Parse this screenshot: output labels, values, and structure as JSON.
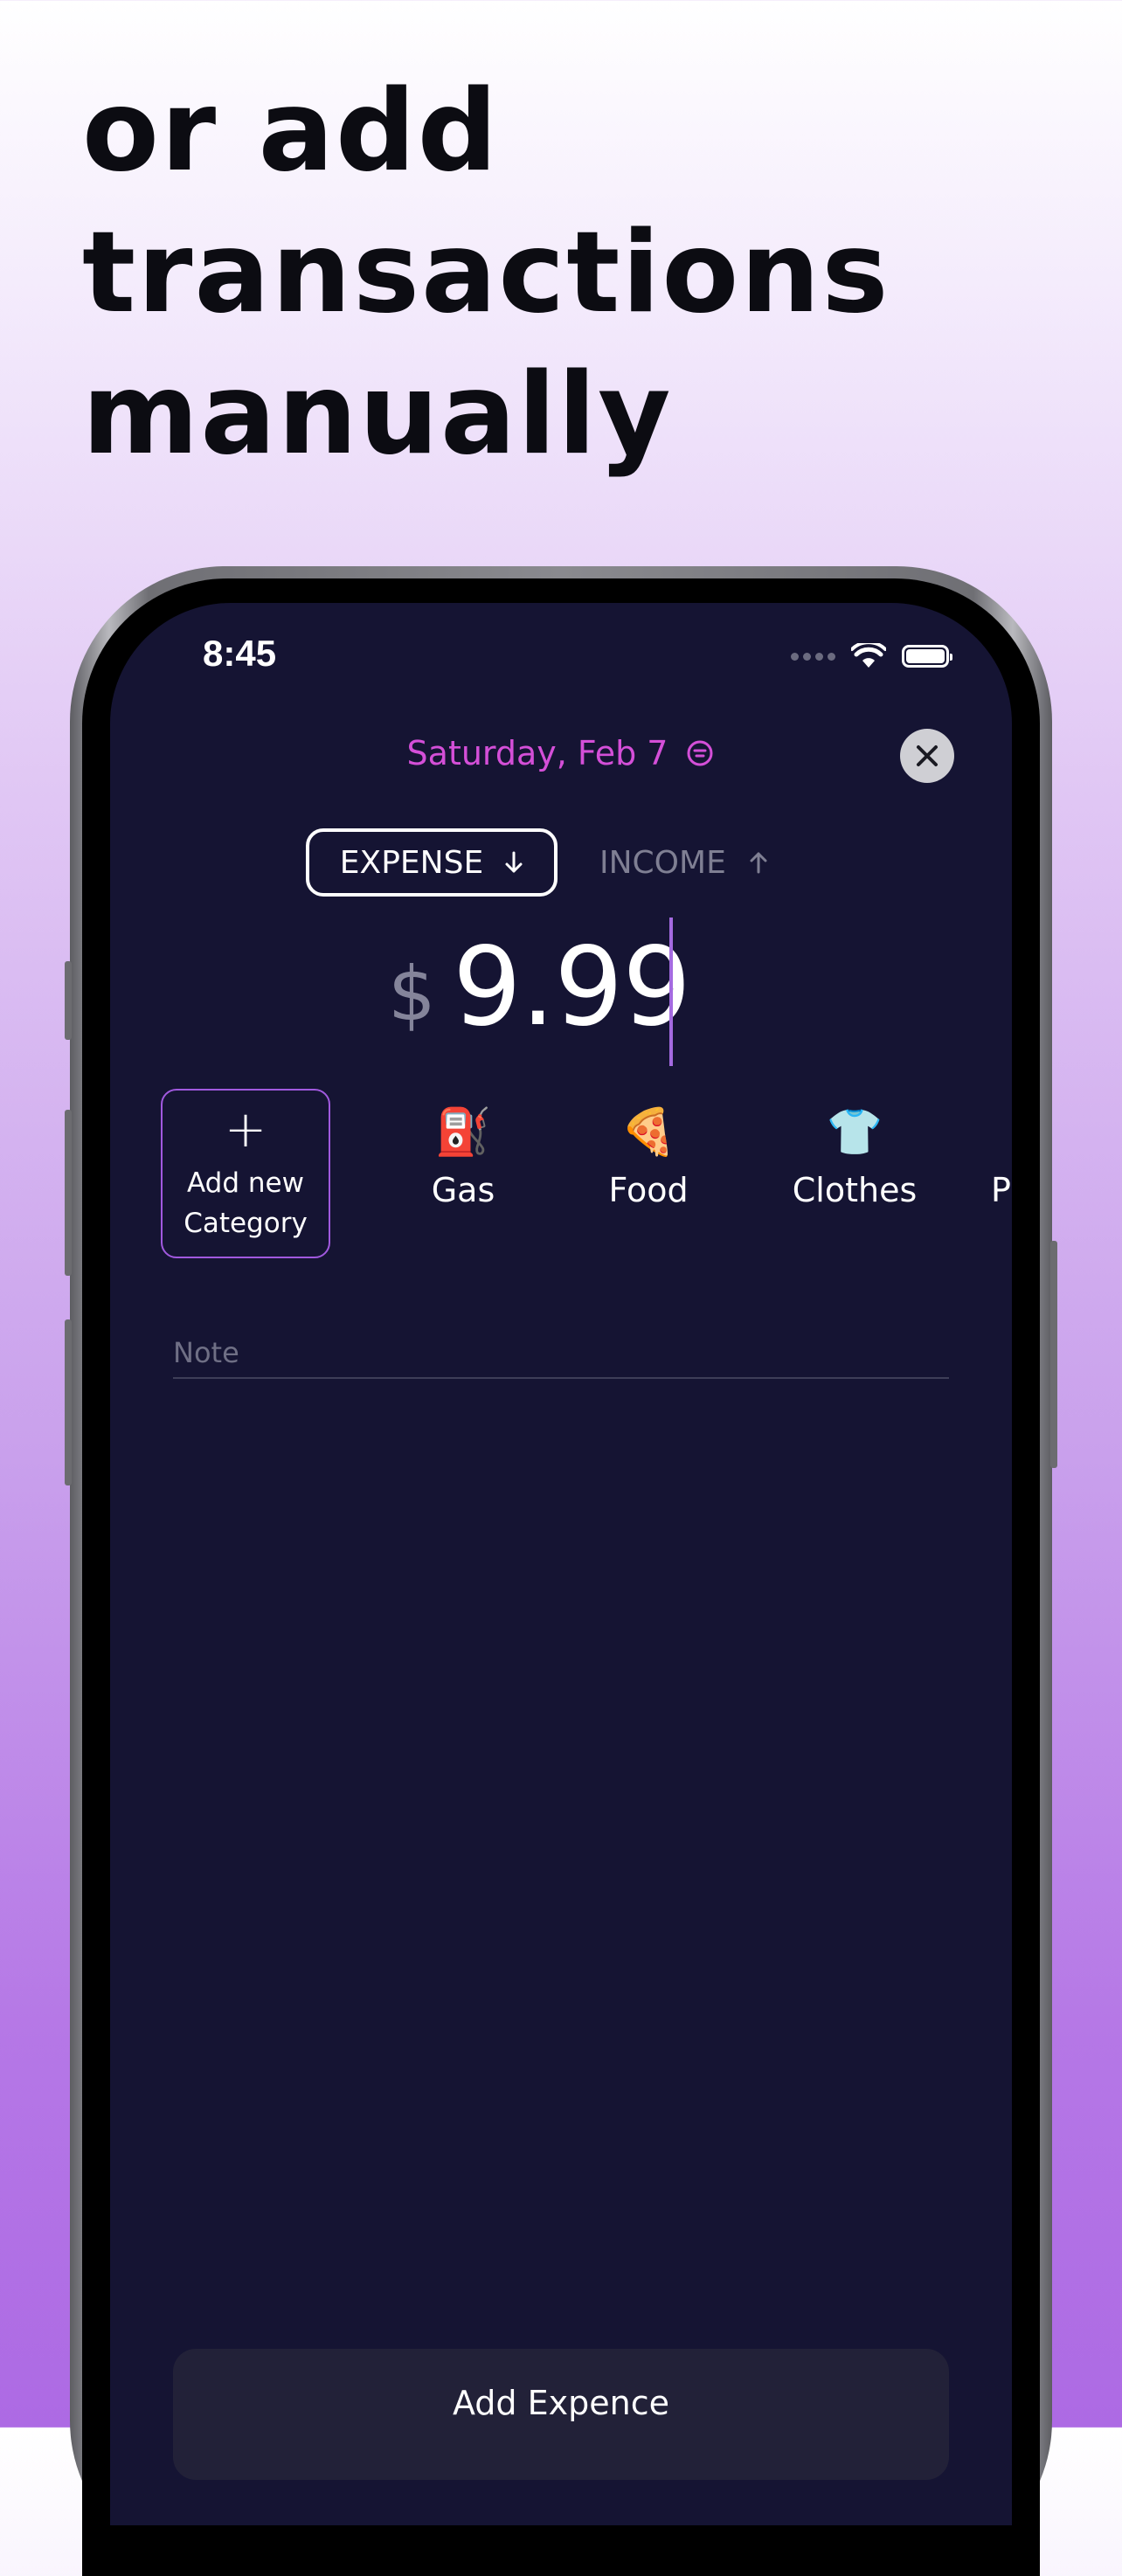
{
  "headline": {
    "lines": [
      "or add",
      "transactions",
      "manually"
    ]
  },
  "status_bar": {
    "time": "8:45"
  },
  "form": {
    "date": "Saturday, Feb 7",
    "type_toggle": {
      "expense_label": "EXPENSE",
      "income_label": "INCOME",
      "selected": "EXPENSE"
    },
    "amount": {
      "currency": "$",
      "value": "9.99"
    },
    "categories": {
      "add_line1": "Add new",
      "add_line2": "Category",
      "items": [
        {
          "emoji": "⛽",
          "label": "Gas"
        },
        {
          "emoji": "🍕",
          "label": "Food"
        },
        {
          "emoji": "👕",
          "label": "Clothes"
        },
        {
          "emoji": "",
          "label": "P"
        }
      ]
    },
    "note_placeholder": "Note",
    "submit_label": "Add Expence"
  },
  "colors": {
    "screen_bg": "#151433",
    "accent_pink": "#d44fd8",
    "accent_purple": "#a159df",
    "button_bg": "#222138"
  }
}
